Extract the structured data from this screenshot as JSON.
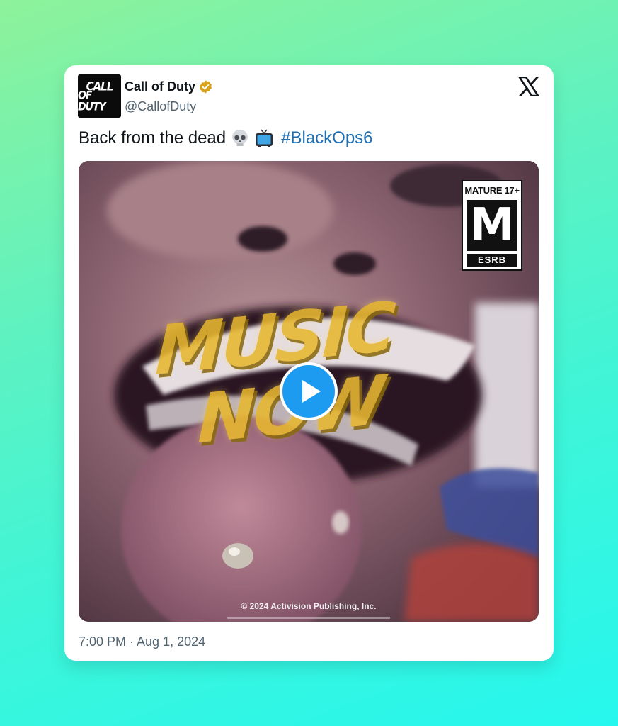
{
  "author": {
    "name": "Call of Duty",
    "handle": "@CallofDuty",
    "avatar_lines": [
      "CALL",
      "OF DUTY"
    ],
    "verified_color": "#d9a21b"
  },
  "tweet": {
    "text": "Back from the dead",
    "emojis": [
      "skull-emoji",
      "tv-emoji"
    ],
    "hashtag": "#BlackOps6",
    "timestamp": "7:00 PM · Aug 1, 2024"
  },
  "media": {
    "rating_top": "MATURE 17+",
    "rating_letter": "M",
    "rating_bottom": "ESRB",
    "overlay_line_1": "MUSIC",
    "overlay_line_2": "NOW",
    "copyright": "© 2024 Activision Publishing, Inc.",
    "play_color": "#1d9bf0"
  },
  "brand": {
    "icon": "x-logo-icon",
    "hashtag_color": "#1d6fb3"
  }
}
